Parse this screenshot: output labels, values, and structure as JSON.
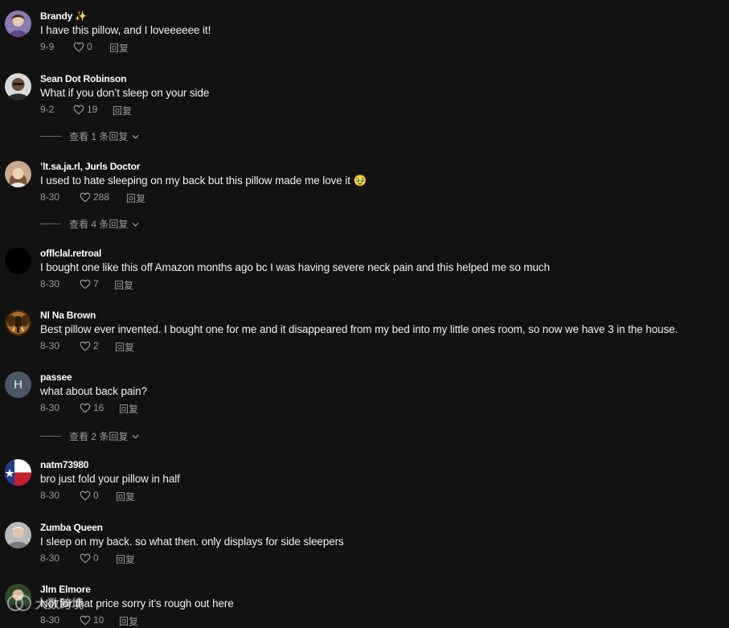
{
  "comments": [
    {
      "author": "Brandy",
      "badge": "✨",
      "text": "I have this pillow, and I loveeeeee it!",
      "date": "9-9",
      "likes": "0",
      "reply_label": "回复",
      "avatar_icon": "user-avatar-photo"
    },
    {
      "author": "Sean Dot Robinson",
      "text": "What if you don’t sleep on your side",
      "date": "9-2",
      "likes": "19",
      "reply_label": "回复",
      "view_replies": "查看 1 条回复",
      "avatar_icon": "user-avatar-photo"
    },
    {
      "author": "’lt.sa.ja.rl, Jurls Doctor",
      "text": "I used to hate sleeping on my back but this pillow made me love it 🥹",
      "date": "8-30",
      "likes": "288",
      "reply_label": "回复",
      "view_replies": "查看 4 条回复",
      "avatar_icon": "user-avatar-photo"
    },
    {
      "author": "offlclal.retroal",
      "text": "I bought one like this off Amazon months ago bc I was having severe neck pain and this helped me so much",
      "date": "8-30",
      "likes": "7",
      "reply_label": "回复",
      "avatar_icon": "user-avatar-black"
    },
    {
      "author": "Nl Na Brown",
      "text": "Best pillow ever invented. I bought one for me and it disappeared from my bed into my little ones room, so now we have 3 in the house.",
      "date": "8-30",
      "likes": "2",
      "reply_label": "回复",
      "avatar_icon": "elephant-avatar"
    },
    {
      "author": "passee",
      "text": "what about back pain?",
      "date": "8-30",
      "likes": "16",
      "reply_label": "回复",
      "view_replies": "查看 2 条回复",
      "avatar_letter": "H",
      "avatar_icon": "letter-avatar"
    },
    {
      "author": "natm73980",
      "text": "bro just fold your pillow in half",
      "date": "8-30",
      "likes": "0",
      "reply_label": "回复",
      "avatar_icon": "texas-flag-avatar"
    },
    {
      "author": "Zumba Queen",
      "text": "I sleep on my back. so what then. only displays for side sleepers",
      "date": "8-30",
      "likes": "0",
      "reply_label": "回复",
      "avatar_icon": "user-avatar-photo"
    },
    {
      "author": "Jlm Elmore",
      "text": "Not for that price sorry it’s rough out here",
      "date": "8-30",
      "likes": "10",
      "reply_label": "回复",
      "avatar_icon": "user-avatar-photo"
    }
  ],
  "watermark": "大数跨境",
  "colors": {
    "background": "#121212",
    "text_primary": "#ffffff",
    "text_secondary": "#9a9a9a"
  }
}
